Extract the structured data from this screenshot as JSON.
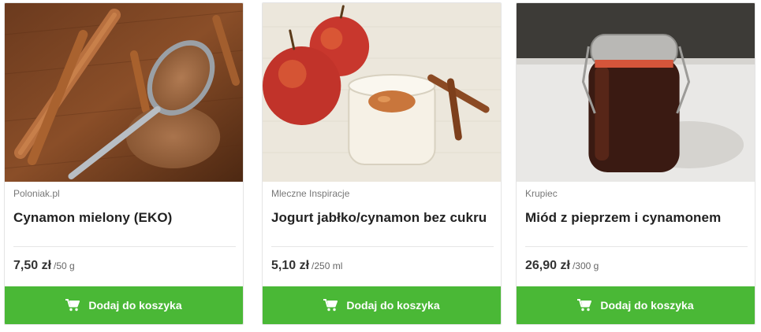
{
  "products": [
    {
      "vendor": "Poloniak.pl",
      "title": "Cynamon mielony (EKO)",
      "price": "7,50 zł",
      "unit": "/50 g",
      "button_label": "Dodaj do koszyka",
      "image_alt": "cinnamon-sticks-and-ground-cinnamon-photo"
    },
    {
      "vendor": "Mleczne Inspiracje",
      "title": "Jogurt jabłko/cynamon bez cukru",
      "price": "5,10 zł",
      "unit": "/250 ml",
      "button_label": "Dodaj do koszyka",
      "image_alt": "apples-and-yogurt-jar-photo"
    },
    {
      "vendor": "Krupiec",
      "title": "Miód z pieprzem i cynamonem",
      "price": "26,90 zł",
      "unit": "/300 g",
      "button_label": "Dodaj do koszyka",
      "image_alt": "honey-jar-photo"
    }
  ],
  "colors": {
    "button_green": "#4ab836",
    "text_dark": "#222222",
    "text_muted": "#777777"
  },
  "icons": {
    "cart": "shopping-cart-icon"
  }
}
